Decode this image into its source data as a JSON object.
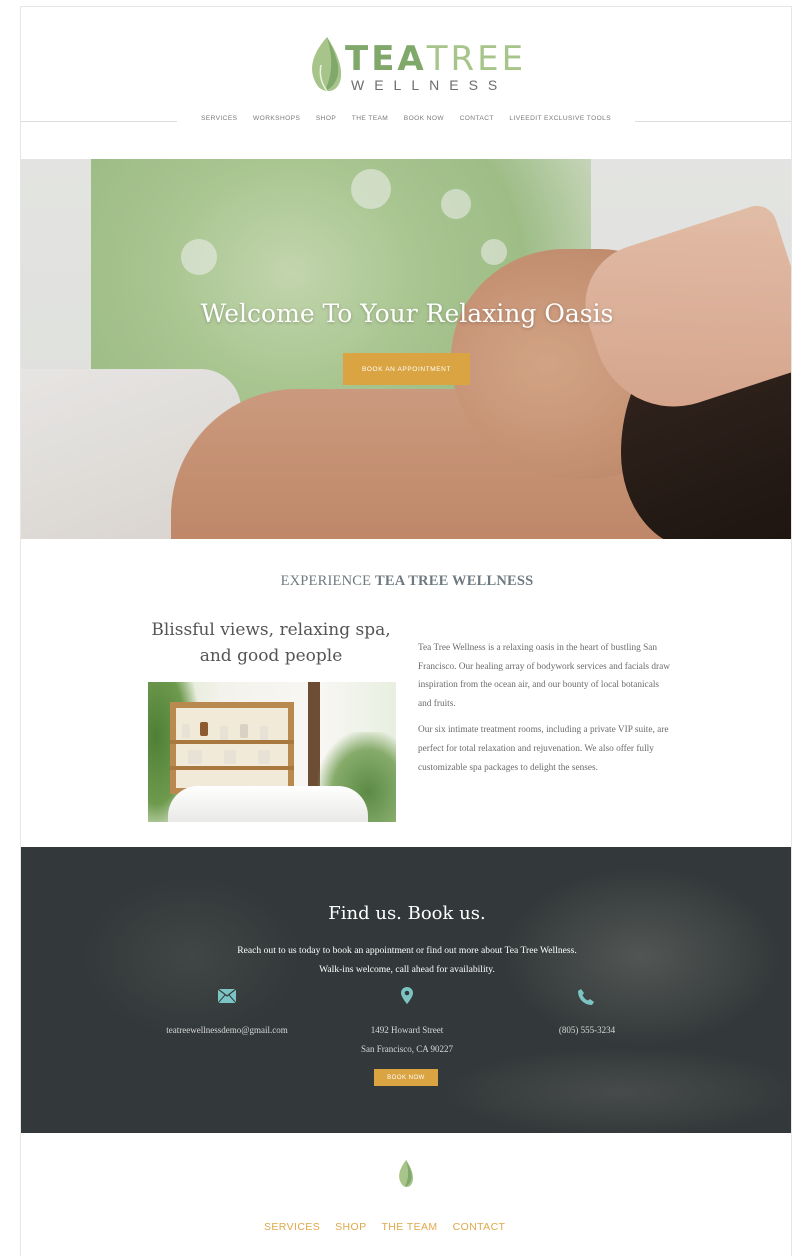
{
  "brand": {
    "name_bold": "TEA",
    "name_light": "TREE",
    "tagline": "WELLNESS",
    "logo_icon": "leaf-icon",
    "accent_green": "#8fb47a",
    "accent_gold": "#d9a441"
  },
  "nav": {
    "items": [
      "SERVICES",
      "WORKSHOPS",
      "SHOP",
      "THE TEAM",
      "BOOK NOW",
      "CONTACT",
      "LIVEEDIT EXCLUSIVE TOOLS"
    ]
  },
  "hero": {
    "title": "Welcome To Your Relaxing Oasis",
    "button": "BOOK AN APPOINTMENT"
  },
  "about": {
    "heading_light": "EXPERIENCE ",
    "heading_bold": "TEA TREE WELLNESS",
    "subheading_line1": "Blissful views, relaxing spa,",
    "subheading_line2": "and good people",
    "paragraph1": "Tea Tree Wellness is a relaxing oasis in the heart of bustling San Francisco. Our healing array of bodywork services and facials draw inspiration from the ocean air, and our bounty of local botanicals and fruits.",
    "paragraph2": "Our six intimate treatment rooms, including a private VIP suite, are perfect for total relaxation and rejuvenation. We also offer fully customizable spa packages to delight the senses."
  },
  "find": {
    "title": "Find us. Book us.",
    "line1": "Reach out to us today to book an appointment or find out more about Tea Tree Wellness.",
    "line2": "Walk-ins welcome, call ahead for availability.",
    "email": "teatreewellnessdemo@gmail.com",
    "address_line1": "1492 Howard Street",
    "address_line2": "San Francisco, CA 90227",
    "phone": "(805) 555-3234",
    "icons": [
      "envelope-icon",
      "map-pin-icon",
      "phone-icon"
    ],
    "icon_color": "#7cc4c4",
    "button": "BOOK NOW"
  },
  "footer": {
    "items": [
      "SERVICES",
      "SHOP",
      "THE TEAM",
      "CONTACT"
    ]
  }
}
